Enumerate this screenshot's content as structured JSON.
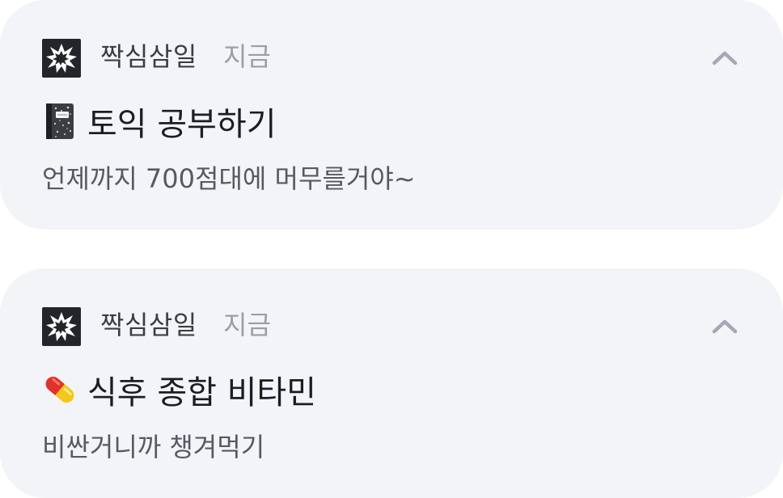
{
  "notifications": [
    {
      "app_icon": "explosion-icon",
      "app_name": "짝심삼일",
      "time": "지금",
      "emoji": "notebook-icon",
      "title": "토익 공부하기",
      "body": "언제까지 700점대에 머무를거야~",
      "collapse_icon": "chevron-up-icon"
    },
    {
      "app_icon": "explosion-icon",
      "app_name": "짝심삼일",
      "time": "지금",
      "emoji": "pill-icon",
      "title": "식후 종합 비타민",
      "body": "비싼거니까 챙겨먹기",
      "collapse_icon": "chevron-up-icon"
    }
  ],
  "colors": {
    "card_background": "#f3f4f7",
    "app_icon_background": "#23252b",
    "title_text": "#1b1d22",
    "secondary_text": "#9a9ea8"
  }
}
